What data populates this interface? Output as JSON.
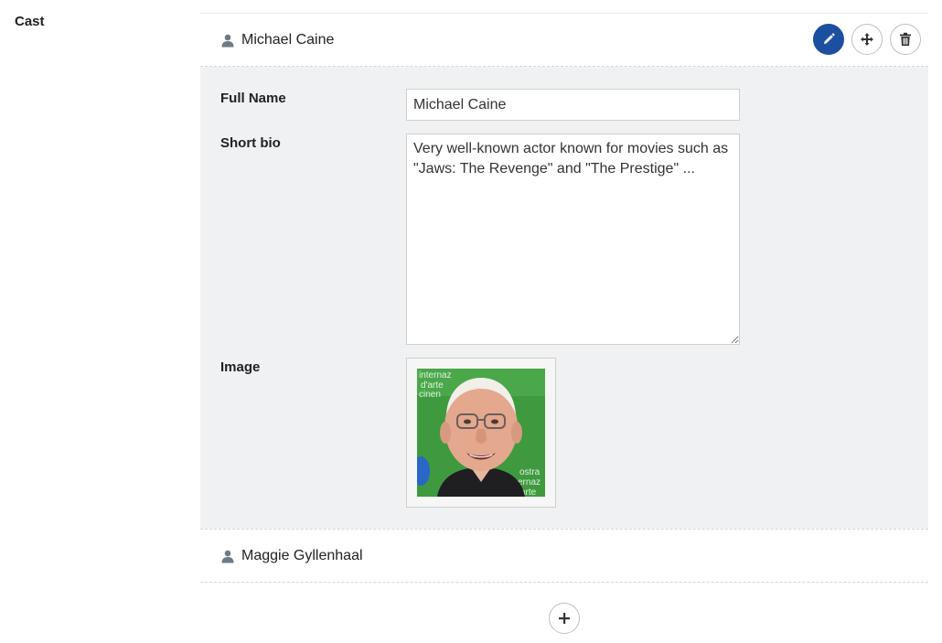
{
  "section": {
    "label": "Cast"
  },
  "cast_items": [
    {
      "name": "Michael Caine",
      "expanded": true,
      "fields": {
        "full_name_label": "Full Name",
        "full_name_value": "Michael Caine",
        "bio_label": "Short bio",
        "bio_value": "Very well-known actor known for movies such as \"Jaws: The Revenge\" and \"The Prestige\" ...",
        "image_label": "Image"
      }
    },
    {
      "name": "Maggie Gyllenhaal",
      "expanded": false
    }
  ],
  "photo_backdrop_text": [
    "internaz",
    "d'arte",
    "cinen",
    "ostra",
    "ernaz",
    "arte"
  ],
  "icons": {
    "person": "person-icon",
    "edit": "pencil-icon",
    "move": "move-arrows-icon",
    "delete": "trash-icon",
    "add": "plus-icon"
  },
  "colors": {
    "primary": "#1d4fa1",
    "panel": "#f0f1f2",
    "photo_bg": "#3f9a3f"
  }
}
